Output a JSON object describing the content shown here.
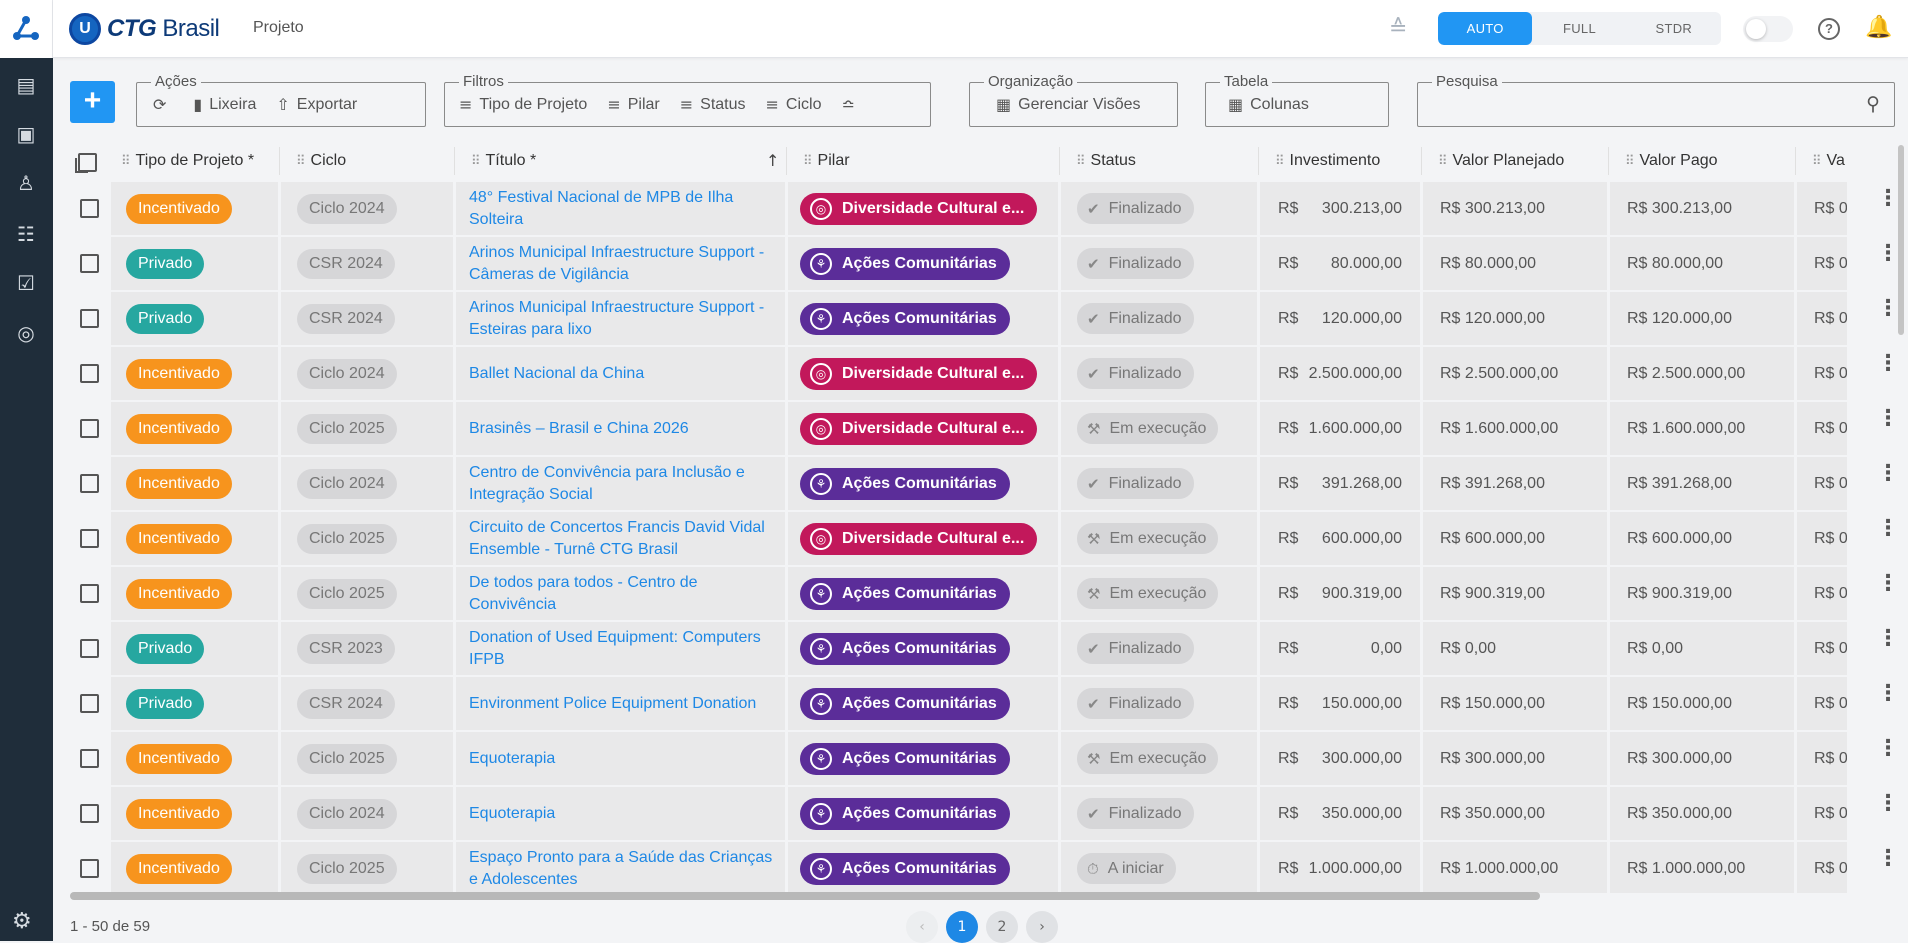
{
  "app": {
    "brand_name": "CTG",
    "brand_suffix": "Brasil",
    "page_name": "Projeto"
  },
  "view_modes": {
    "items": [
      "AUTO",
      "FULL",
      "STDR"
    ],
    "selected": "AUTO"
  },
  "toolbar": {
    "add_label": "+",
    "actions": {
      "label": "Ações",
      "items": [
        {
          "icon": "refresh-icon",
          "label": ""
        },
        {
          "icon": "trash-icon",
          "label": "Lixeira"
        },
        {
          "icon": "export-icon",
          "label": "Exportar"
        }
      ]
    },
    "filters": {
      "label": "Filtros",
      "items": [
        "Tipo de Projeto",
        "Pilar",
        "Status",
        "Ciclo"
      ]
    },
    "organization": {
      "label": "Organização",
      "button": "Gerenciar Visões"
    },
    "table": {
      "label": "Tabela",
      "button": "Colunas"
    },
    "search": {
      "label": "Pesquisa",
      "value": ""
    }
  },
  "columns": [
    "Tipo de Projeto *",
    "Ciclo",
    "Título *",
    "Pilar",
    "Status",
    "Investimento",
    "Valor Planejado",
    "Valor Pago",
    "Va"
  ],
  "rows": [
    {
      "tipo": "Incentivado",
      "ciclo": "Ciclo 2024",
      "titulo": "48° Festival Nacional de MPB de Ilha Solteira",
      "pilar": "Diversidade Cultural e...",
      "pilar_kind": "div",
      "status": "Finalizado",
      "inv_prefix": "R$",
      "inv": "300.213,00",
      "planejado": "R$ 300.213,00",
      "pago": "R$ 300.213,00",
      "va": "R$ 0"
    },
    {
      "tipo": "Privado",
      "ciclo": "CSR 2024",
      "titulo": "Arinos Municipal Infraestructure Support - Câmeras de Vigilância",
      "pilar": "Ações Comunitárias",
      "pilar_kind": "acc",
      "status": "Finalizado",
      "inv_prefix": "R$",
      "inv": "80.000,00",
      "planejado": "R$ 80.000,00",
      "pago": "R$ 80.000,00",
      "va": "R$ 0"
    },
    {
      "tipo": "Privado",
      "ciclo": "CSR 2024",
      "titulo": "Arinos Municipal Infraestructure Support - Esteiras para lixo",
      "pilar": "Ações Comunitárias",
      "pilar_kind": "acc",
      "status": "Finalizado",
      "inv_prefix": "R$",
      "inv": "120.000,00",
      "planejado": "R$ 120.000,00",
      "pago": "R$ 120.000,00",
      "va": "R$ 0"
    },
    {
      "tipo": "Incentivado",
      "ciclo": "Ciclo 2024",
      "titulo": "Ballet Nacional da China",
      "pilar": "Diversidade Cultural e...",
      "pilar_kind": "div",
      "status": "Finalizado",
      "inv_prefix": "R$",
      "inv": "2.500.000,00",
      "planejado": "R$ 2.500.000,00",
      "pago": "R$ 2.500.000,00",
      "va": "R$ 0"
    },
    {
      "tipo": "Incentivado",
      "ciclo": "Ciclo 2025",
      "titulo": "Brasinês – Brasil e China 2026",
      "pilar": "Diversidade Cultural e...",
      "pilar_kind": "div",
      "status": "Em execução",
      "inv_prefix": "R$",
      "inv": "1.600.000,00",
      "planejado": "R$ 1.600.000,00",
      "pago": "R$ 1.600.000,00",
      "va": "R$ 0"
    },
    {
      "tipo": "Incentivado",
      "ciclo": "Ciclo 2024",
      "titulo": "Centro de Convivência para Inclusão e Integração Social",
      "pilar": "Ações Comunitárias",
      "pilar_kind": "acc",
      "status": "Finalizado",
      "inv_prefix": "R$",
      "inv": "391.268,00",
      "planejado": "R$ 391.268,00",
      "pago": "R$ 391.268,00",
      "va": "R$ 0"
    },
    {
      "tipo": "Incentivado",
      "ciclo": "Ciclo 2025",
      "titulo": "Circuito de Concertos Francis David Vidal Ensemble - Turnê CTG Brasil",
      "pilar": "Diversidade Cultural e...",
      "pilar_kind": "div",
      "status": "Em execução",
      "inv_prefix": "R$",
      "inv": "600.000,00",
      "planejado": "R$ 600.000,00",
      "pago": "R$ 600.000,00",
      "va": "R$ 0"
    },
    {
      "tipo": "Incentivado",
      "ciclo": "Ciclo 2025",
      "titulo": "De todos para todos - Centro de Convivência",
      "pilar": "Ações Comunitárias",
      "pilar_kind": "acc",
      "status": "Em execução",
      "inv_prefix": "R$",
      "inv": "900.319,00",
      "planejado": "R$ 900.319,00",
      "pago": "R$ 900.319,00",
      "va": "R$ 0"
    },
    {
      "tipo": "Privado",
      "ciclo": "CSR 2023",
      "titulo": "Donation of Used Equipment: Computers IFPB",
      "pilar": "Ações Comunitárias",
      "pilar_kind": "acc",
      "status": "Finalizado",
      "inv_prefix": "R$",
      "inv": "0,00",
      "planejado": "R$ 0,00",
      "pago": "R$ 0,00",
      "va": "R$ 0"
    },
    {
      "tipo": "Privado",
      "ciclo": "CSR 2024",
      "titulo": "Environment Police Equipment Donation",
      "pilar": "Ações Comunitárias",
      "pilar_kind": "acc",
      "status": "Finalizado",
      "inv_prefix": "R$",
      "inv": "150.000,00",
      "planejado": "R$ 150.000,00",
      "pago": "R$ 150.000,00",
      "va": "R$ 0"
    },
    {
      "tipo": "Incentivado",
      "ciclo": "Ciclo 2025",
      "titulo": "Equoterapia",
      "pilar": "Ações Comunitárias",
      "pilar_kind": "acc",
      "status": "Em execução",
      "inv_prefix": "R$",
      "inv": "300.000,00",
      "planejado": "R$ 300.000,00",
      "pago": "R$ 300.000,00",
      "va": "R$ 0"
    },
    {
      "tipo": "Incentivado",
      "ciclo": "Ciclo 2024",
      "titulo": "Equoterapia",
      "pilar": "Ações Comunitárias",
      "pilar_kind": "acc",
      "status": "Finalizado",
      "inv_prefix": "R$",
      "inv": "350.000,00",
      "planejado": "R$ 350.000,00",
      "pago": "R$ 350.000,00",
      "va": "R$ 0"
    },
    {
      "tipo": "Incentivado",
      "ciclo": "Ciclo 2025",
      "titulo": "Espaço Pronto para a Saúde das Crianças e Adolescentes",
      "pilar": "Ações Comunitárias",
      "pilar_kind": "acc",
      "status": "A iniciar",
      "inv_prefix": "R$",
      "inv": "1.000.000,00",
      "planejado": "R$ 1.000.000,00",
      "pago": "R$ 1.000.000,00",
      "va": "R$ 0"
    }
  ],
  "footer": {
    "count": "1 - 50 de 59",
    "pages": [
      "1",
      "2"
    ],
    "current_page": "1"
  }
}
